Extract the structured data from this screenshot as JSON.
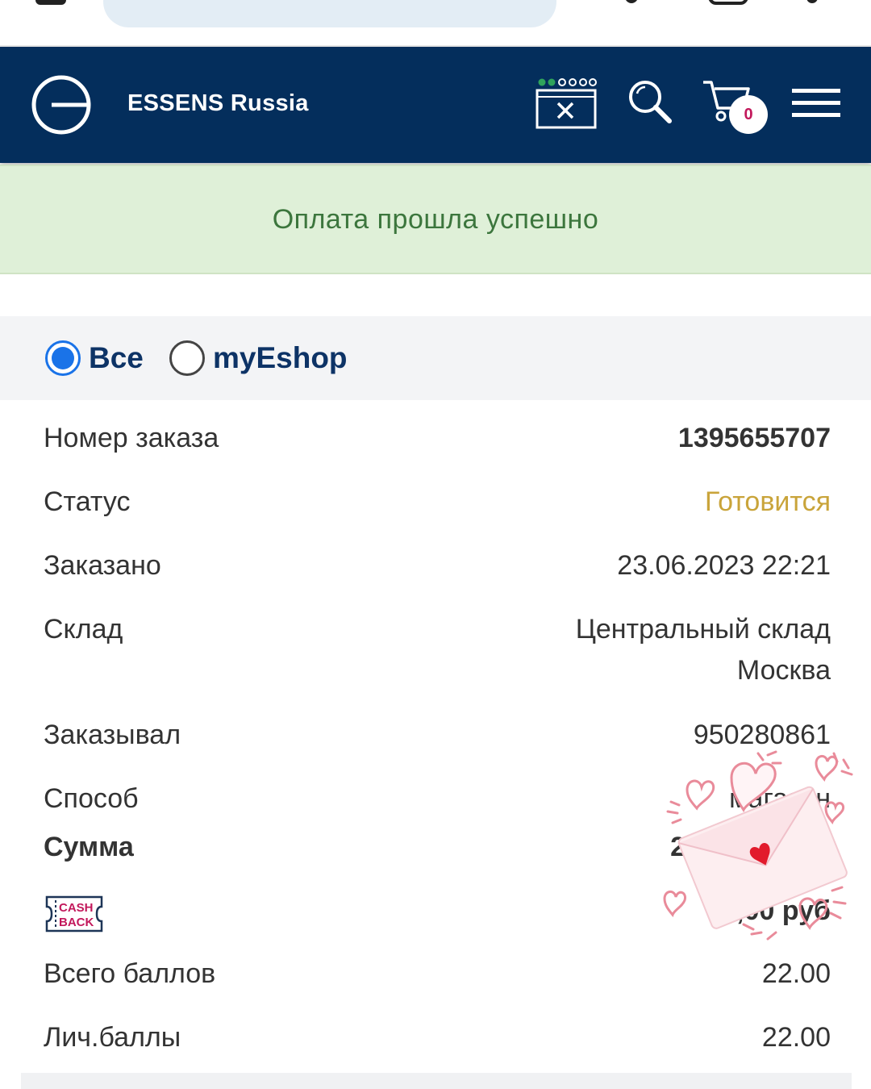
{
  "header": {
    "brand": "ESSENS Russia",
    "cart_count": "0",
    "icons": [
      "logo-icon",
      "window-close-icon",
      "search-icon",
      "cart-icon",
      "hamburger-menu-icon"
    ]
  },
  "alert": {
    "message": "Оплата прошла успешно"
  },
  "filter": {
    "options": [
      {
        "label": "Все",
        "selected": true
      },
      {
        "label": "myEshop",
        "selected": false
      }
    ]
  },
  "order": {
    "number_label": "Номер заказа",
    "number_value": "1395655707",
    "status_label": "Статус",
    "status_value": "Готовится",
    "ordered_label": "Заказано",
    "ordered_value": "23.06.2023 22:21",
    "warehouse_label": "Склад",
    "warehouse_value_line1": "Центральный склад",
    "warehouse_value_line2": "Москва",
    "orderedby_label": "Заказывал",
    "orderedby_value": "950280861",
    "method_label": "Способ",
    "method_value": "магазин",
    "sum_label": "Сумма",
    "sum_value": "2 ",
    "cashback_badge_line1": "CASH",
    "cashback_badge_line2": "BACK",
    "cashback_value": "3   ,00 руб",
    "total_points_label": "Всего баллов",
    "total_points_value": "22.00",
    "personal_points_label": "Лич.баллы",
    "personal_points_value": "22.00"
  },
  "colors": {
    "header_bg": "#042e5c",
    "alert_bg": "#dff0d8",
    "alert_text": "#3c763d",
    "status_color": "#c9a43a",
    "radio_accent": "#1a73e8",
    "badge_text": "#c2185b"
  }
}
